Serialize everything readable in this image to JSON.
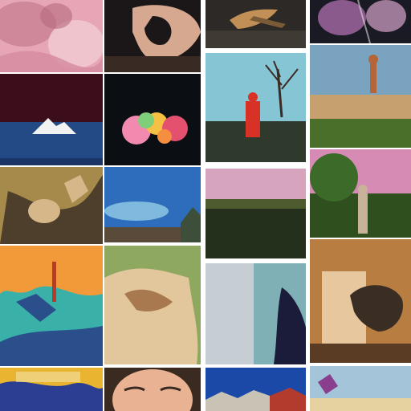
{
  "collage": {
    "background": "#ffffff",
    "tile_count": 20,
    "tiles": [
      {
        "name": "pink-patterned-fabric",
        "palette": [
          "#e7a6b6",
          "#c97f93",
          "#f1c8cf"
        ]
      },
      {
        "name": "dark-curved-shape",
        "palette": [
          "#1b1718",
          "#d6a88f",
          "#3a2a24"
        ]
      },
      {
        "name": "dark-scene-with-stretched-object",
        "palette": [
          "#2c2926",
          "#7a5a37",
          "#c28f57"
        ]
      },
      {
        "name": "dark-purple-abstract",
        "palette": [
          "#1a1a24",
          "#8b5a8c",
          "#d5a4cb"
        ]
      },
      {
        "name": "dark-red-sky-over-blue-water",
        "palette": [
          "#3c0e1b",
          "#244a86",
          "#f2f2f2"
        ]
      },
      {
        "name": "flower-bouquet-on-black",
        "palette": [
          "#0b0e13",
          "#f28ab0",
          "#f5c043"
        ]
      },
      {
        "name": "person-in-red-under-tree",
        "palette": [
          "#86c5d4",
          "#d83226",
          "#2f3a2d"
        ]
      },
      {
        "name": "golden-field-with-hanging-figure",
        "palette": [
          "#7aa3c0",
          "#c6a06e",
          "#4a6f2b"
        ]
      },
      {
        "name": "distorted-figure-in-grass",
        "palette": [
          "#a58a4b",
          "#4d3f2b",
          "#d6b78a"
        ]
      },
      {
        "name": "blue-sky-landscape",
        "palette": [
          "#2d6dbb",
          "#7fb9de",
          "#5a4a3a"
        ]
      },
      {
        "name": "pink-sky-green-field",
        "palette": [
          "#d7a4bd",
          "#4e5b2e",
          "#24301c"
        ]
      },
      {
        "name": "green-field-with-tree-and-figure",
        "palette": [
          "#d58bb3",
          "#2f4f1f",
          "#c9b29a"
        ]
      },
      {
        "name": "colorful-abstract-painting",
        "palette": [
          "#f29a3a",
          "#39b1a8",
          "#2a4f8a"
        ]
      },
      {
        "name": "beige-sculpture-on-grass",
        "palette": [
          "#8ea860",
          "#e3c79c",
          "#a8794e"
        ]
      },
      {
        "name": "misty-blue-abstract",
        "palette": [
          "#c6cdd3",
          "#7fb0b5",
          "#1b1b3a"
        ]
      },
      {
        "name": "room-with-sculpted-head",
        "palette": [
          "#b87d40",
          "#e6c79e",
          "#3a2d24"
        ]
      },
      {
        "name": "blue-and-yellow-abstract",
        "palette": [
          "#e9b531",
          "#2c3e92",
          "#f2e3a8"
        ]
      },
      {
        "name": "close-up-face",
        "palette": [
          "#e8b293",
          "#3a2a20",
          "#c1836a"
        ]
      },
      {
        "name": "blue-sky-with-rooftops",
        "palette": [
          "#1a49a8",
          "#c9c3b6",
          "#b33b2e"
        ]
      },
      {
        "name": "purple-flower-landscape",
        "palette": [
          "#a4c4da",
          "#8a3f8e",
          "#e6d2a0"
        ]
      }
    ]
  }
}
